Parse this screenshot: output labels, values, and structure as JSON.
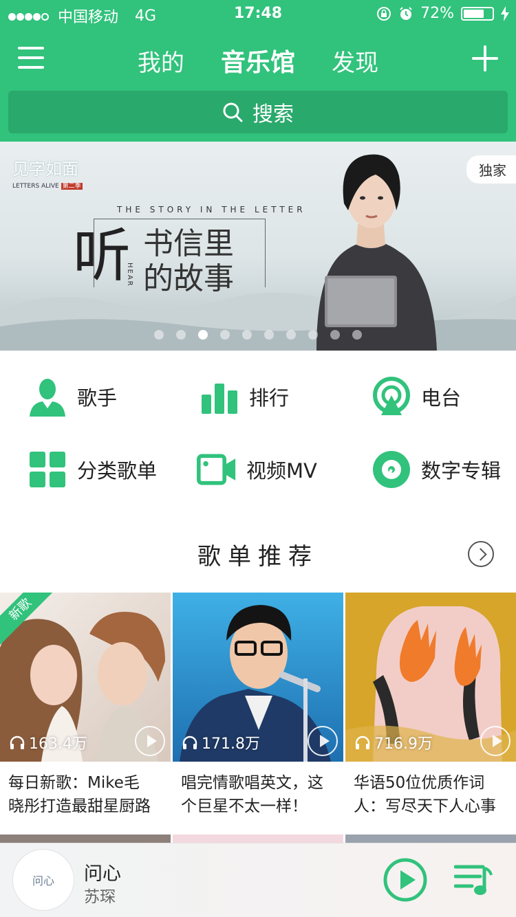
{
  "status_bar": {
    "carrier": "中国移动",
    "network": "4G",
    "time": "17:48",
    "battery": "72%",
    "battery_level": 0.72
  },
  "header": {
    "tabs": [
      {
        "label": "我的",
        "active": false
      },
      {
        "label": "音乐馆",
        "active": true
      },
      {
        "label": "发现",
        "active": false
      }
    ],
    "search_placeholder": "搜索"
  },
  "banner": {
    "logo": "见字如面",
    "logo_sub": "LETTERS ALIVE",
    "logo_season": "第二季",
    "tag": "独家",
    "english": "THE STORY IN THE LETTER",
    "big_char": "听",
    "side_text": "HEAR",
    "line1": "书信里",
    "line2": "的故事",
    "page_count": 10,
    "current_page": 3
  },
  "categories": [
    {
      "label": "歌手",
      "icon": "singer-icon"
    },
    {
      "label": "排行",
      "icon": "chart-icon"
    },
    {
      "label": "电台",
      "icon": "radio-icon"
    },
    {
      "label": "分类歌单",
      "icon": "grid-icon"
    },
    {
      "label": "视频MV",
      "icon": "video-icon"
    },
    {
      "label": "数字专辑",
      "icon": "album-icon"
    }
  ],
  "section": {
    "title": "歌单推荐"
  },
  "playlists": [
    {
      "title_line1": "每日新歌：Mike毛",
      "title_line2": "晓彤打造最甜星厨路",
      "plays": "163.4万",
      "badge": "新歌"
    },
    {
      "title_line1": "唱完情歌唱英文，这",
      "title_line2": "个巨星不太一样！",
      "plays": "171.8万"
    },
    {
      "title_line1": "华语50位优质作词",
      "title_line2": "人：写尽天下人心事",
      "plays": "716.9万"
    }
  ],
  "player": {
    "song": "问心",
    "artist": "苏琛",
    "disc_text": "问心"
  },
  "colors": {
    "brand": "#31c27c",
    "search_bg": "#2aa96c"
  }
}
